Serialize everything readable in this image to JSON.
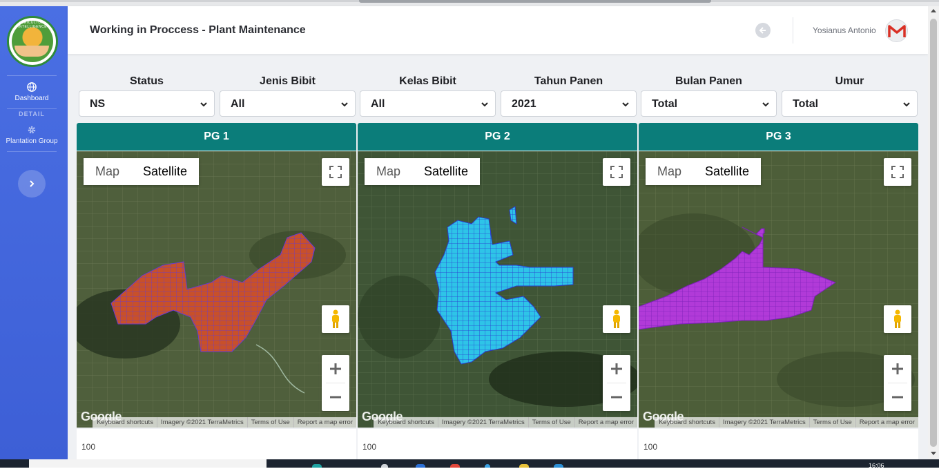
{
  "app": {
    "page_title": "Working in Proccess - Plant Maintenance",
    "logo_text": "AGRICULTURE INTELLIGENCE"
  },
  "user": {
    "name": "Yosianus Antonio",
    "avatar_icon": "gmail-m-icon"
  },
  "sidebar": {
    "items": [
      {
        "label": "Dashboard",
        "icon": "globe-icon"
      },
      {
        "label": "Plantation Group",
        "icon": "gear-icon"
      }
    ],
    "section_heading": "DETAIL",
    "toggle_icon": "chevron-right-icon"
  },
  "filters": [
    {
      "label": "Status",
      "value": "NS"
    },
    {
      "label": "Jenis Bibit",
      "value": "All"
    },
    {
      "label": "Kelas Bibit",
      "value": "All"
    },
    {
      "label": "Tahun Panen",
      "value": "2021"
    },
    {
      "label": "Bulan Panen",
      "value": "Total"
    },
    {
      "label": "Umur",
      "value": "Total"
    }
  ],
  "panels": [
    {
      "title": "PG 1",
      "value": "100",
      "overlay_color": "#c8502a",
      "overlay_edge": "#6a3ad0"
    },
    {
      "title": "PG 2",
      "value": "100",
      "overlay_color": "#2ec4e8",
      "overlay_edge": "#2a3ad0"
    },
    {
      "title": "PG 3",
      "value": "100",
      "overlay_color": "#b13ad8",
      "overlay_edge": "#7a20b8"
    }
  ],
  "map_controls": {
    "map_label": "Map",
    "satellite_label": "Satellite",
    "zoom_in": "+",
    "zoom_out": "−",
    "google": "Google",
    "footer": [
      "Keyboard shortcuts",
      "Imagery ©2021 TerraMetrics",
      "Terms of Use",
      "Report a map error"
    ]
  },
  "colors": {
    "sidebar": "#4a6fe3",
    "panel_header": "#0b7d7a",
    "page_bg": "#eff1f4"
  },
  "taskbar": {
    "clock": "16:06"
  }
}
